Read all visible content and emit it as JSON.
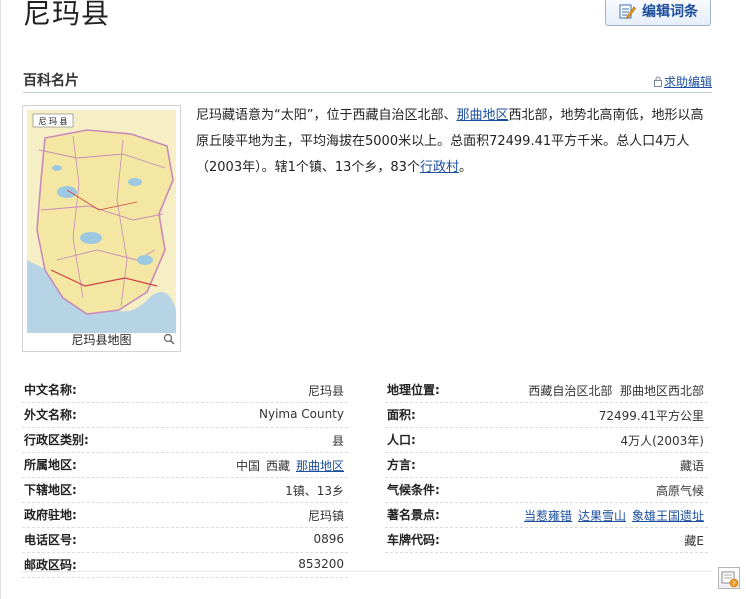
{
  "page": {
    "title": "尼玛县"
  },
  "toolbar": {
    "edit_label": "编辑词条",
    "edit_icon": "edit-icon"
  },
  "card": {
    "title": "百科名片",
    "help_label": "求助编辑"
  },
  "map": {
    "caption": "尼玛县地图",
    "map_label": "尼 玛 县"
  },
  "intro": {
    "p1": "尼玛藏语意为“太阳”，位于西藏自治区北部、",
    "link1": "那曲地区",
    "p2": "西北部，地势北高南低，地形以高原丘陵平地为主，平均海拔在5000米以上。总面积72499.41平方千米。总人口4万人（2003年）。辖1个镇、13个乡，83个",
    "link2": "行政村",
    "p3": "。"
  },
  "info_left": [
    {
      "key": "中文名称:",
      "value": "尼玛县"
    },
    {
      "key": "外文名称:",
      "value": "Nyima County"
    },
    {
      "key": "行政区类别:",
      "value": "县"
    },
    {
      "key": "所属地区:",
      "parts": [
        "中国",
        "西藏"
      ],
      "link": "那曲地区"
    },
    {
      "key": "下辖地区:",
      "value": "1镇、13乡"
    },
    {
      "key": "政府驻地:",
      "value": "尼玛镇"
    },
    {
      "key": "电话区号:",
      "value": "0896"
    },
    {
      "key": "邮政区码:",
      "value": "853200"
    }
  ],
  "info_right": [
    {
      "key": "地理位置:",
      "value": "西藏自治区北部  那曲地区西北部"
    },
    {
      "key": "面积:",
      "value": "72499.41平方公里"
    },
    {
      "key": "人口:",
      "value": "4万人(2003年)"
    },
    {
      "key": "方言:",
      "value": "藏语"
    },
    {
      "key": "气候条件:",
      "value": "高原气候"
    },
    {
      "key": "著名景点:",
      "links": [
        "当惹雍错",
        "达果雪山",
        "象雄王国遗址"
      ]
    },
    {
      "key": "车牌代码:",
      "value": "藏E"
    }
  ],
  "colors": {
    "link": "#1c4fa0",
    "accent": "#1f4f9c",
    "map_land": "#f3e7a3",
    "map_water": "#a7cde6"
  }
}
